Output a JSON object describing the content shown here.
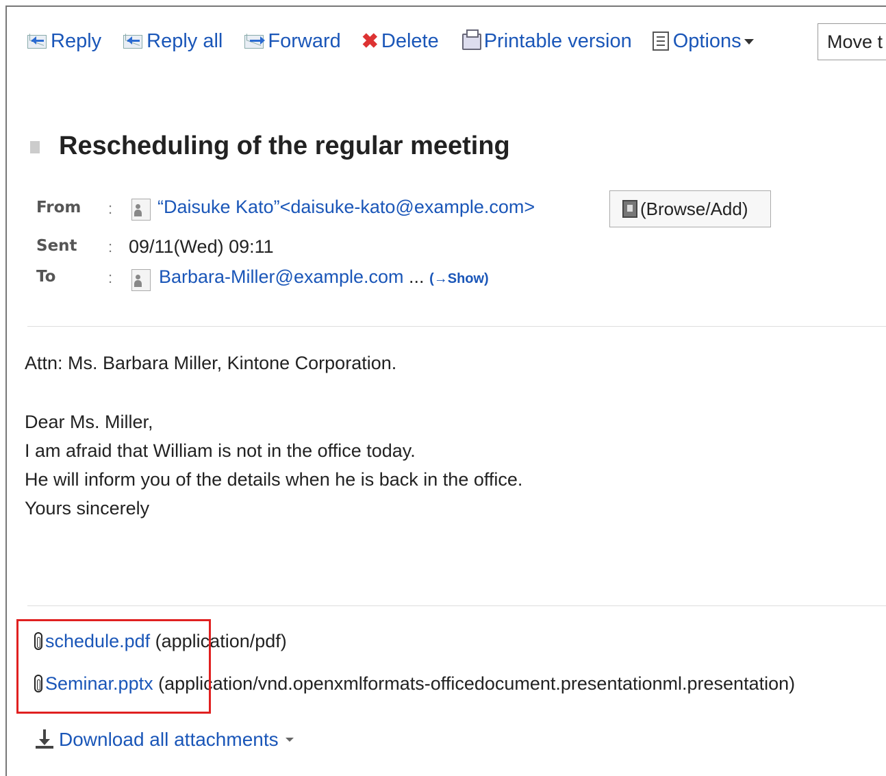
{
  "toolbar": {
    "reply": "Reply",
    "reply_all": "Reply all",
    "forward": "Forward",
    "delete": "Delete",
    "printable": "Printable version",
    "options": "Options",
    "move": "Move t"
  },
  "message": {
    "subject": "Rescheduling of the regular meeting",
    "from_label": "From",
    "from_value": "“Daisuke Kato”<daisuke-kato@example.com>",
    "browse_add": "(Browse/Add)",
    "sent_label": "Sent",
    "sent_value": "09/11(Wed) 09:11",
    "to_label": "To",
    "to_value": "Barbara-Miller@example.com",
    "to_ellipsis": "...",
    "show_link": "(→Show)",
    "colon": ":"
  },
  "body": {
    "line1": "Attn: Ms. Barbara Miller, Kintone Corporation.",
    "line2": "Dear Ms. Miller,",
    "line3": "I am afraid that William is not in the office today.",
    "line4": "He will inform you of the details when he is back in the office.",
    "line5": "Yours sincerely"
  },
  "attachments": [
    {
      "name": "schedule.pdf",
      "type": "(application/pdf)"
    },
    {
      "name": "Seminar.pptx",
      "type": "(application/vnd.openxmlformats-officedocument.presentationml.presentation)"
    }
  ],
  "download_all": "Download all attachments",
  "colors": {
    "link": "#1a56b8",
    "delete": "#dd3333",
    "highlight": "#e02020"
  }
}
